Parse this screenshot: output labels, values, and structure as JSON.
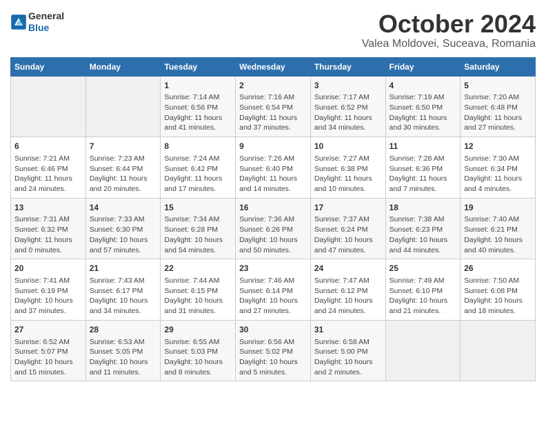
{
  "header": {
    "logo_line1": "General",
    "logo_line2": "Blue",
    "month": "October 2024",
    "location": "Valea Moldovei, Suceava, Romania"
  },
  "days_of_week": [
    "Sunday",
    "Monday",
    "Tuesday",
    "Wednesday",
    "Thursday",
    "Friday",
    "Saturday"
  ],
  "weeks": [
    [
      {
        "day": "",
        "info": ""
      },
      {
        "day": "",
        "info": ""
      },
      {
        "day": "1",
        "info": "Sunrise: 7:14 AM\nSunset: 6:56 PM\nDaylight: 11 hours and 41 minutes."
      },
      {
        "day": "2",
        "info": "Sunrise: 7:16 AM\nSunset: 6:54 PM\nDaylight: 11 hours and 37 minutes."
      },
      {
        "day": "3",
        "info": "Sunrise: 7:17 AM\nSunset: 6:52 PM\nDaylight: 11 hours and 34 minutes."
      },
      {
        "day": "4",
        "info": "Sunrise: 7:19 AM\nSunset: 6:50 PM\nDaylight: 11 hours and 30 minutes."
      },
      {
        "day": "5",
        "info": "Sunrise: 7:20 AM\nSunset: 6:48 PM\nDaylight: 11 hours and 27 minutes."
      }
    ],
    [
      {
        "day": "6",
        "info": "Sunrise: 7:21 AM\nSunset: 6:46 PM\nDaylight: 11 hours and 24 minutes."
      },
      {
        "day": "7",
        "info": "Sunrise: 7:23 AM\nSunset: 6:44 PM\nDaylight: 11 hours and 20 minutes."
      },
      {
        "day": "8",
        "info": "Sunrise: 7:24 AM\nSunset: 6:42 PM\nDaylight: 11 hours and 17 minutes."
      },
      {
        "day": "9",
        "info": "Sunrise: 7:26 AM\nSunset: 6:40 PM\nDaylight: 11 hours and 14 minutes."
      },
      {
        "day": "10",
        "info": "Sunrise: 7:27 AM\nSunset: 6:38 PM\nDaylight: 11 hours and 10 minutes."
      },
      {
        "day": "11",
        "info": "Sunrise: 7:28 AM\nSunset: 6:36 PM\nDaylight: 11 hours and 7 minutes."
      },
      {
        "day": "12",
        "info": "Sunrise: 7:30 AM\nSunset: 6:34 PM\nDaylight: 11 hours and 4 minutes."
      }
    ],
    [
      {
        "day": "13",
        "info": "Sunrise: 7:31 AM\nSunset: 6:32 PM\nDaylight: 11 hours and 0 minutes."
      },
      {
        "day": "14",
        "info": "Sunrise: 7:33 AM\nSunset: 6:30 PM\nDaylight: 10 hours and 57 minutes."
      },
      {
        "day": "15",
        "info": "Sunrise: 7:34 AM\nSunset: 6:28 PM\nDaylight: 10 hours and 54 minutes."
      },
      {
        "day": "16",
        "info": "Sunrise: 7:36 AM\nSunset: 6:26 PM\nDaylight: 10 hours and 50 minutes."
      },
      {
        "day": "17",
        "info": "Sunrise: 7:37 AM\nSunset: 6:24 PM\nDaylight: 10 hours and 47 minutes."
      },
      {
        "day": "18",
        "info": "Sunrise: 7:38 AM\nSunset: 6:23 PM\nDaylight: 10 hours and 44 minutes."
      },
      {
        "day": "19",
        "info": "Sunrise: 7:40 AM\nSunset: 6:21 PM\nDaylight: 10 hours and 40 minutes."
      }
    ],
    [
      {
        "day": "20",
        "info": "Sunrise: 7:41 AM\nSunset: 6:19 PM\nDaylight: 10 hours and 37 minutes."
      },
      {
        "day": "21",
        "info": "Sunrise: 7:43 AM\nSunset: 6:17 PM\nDaylight: 10 hours and 34 minutes."
      },
      {
        "day": "22",
        "info": "Sunrise: 7:44 AM\nSunset: 6:15 PM\nDaylight: 10 hours and 31 minutes."
      },
      {
        "day": "23",
        "info": "Sunrise: 7:46 AM\nSunset: 6:14 PM\nDaylight: 10 hours and 27 minutes."
      },
      {
        "day": "24",
        "info": "Sunrise: 7:47 AM\nSunset: 6:12 PM\nDaylight: 10 hours and 24 minutes."
      },
      {
        "day": "25",
        "info": "Sunrise: 7:49 AM\nSunset: 6:10 PM\nDaylight: 10 hours and 21 minutes."
      },
      {
        "day": "26",
        "info": "Sunrise: 7:50 AM\nSunset: 6:08 PM\nDaylight: 10 hours and 18 minutes."
      }
    ],
    [
      {
        "day": "27",
        "info": "Sunrise: 6:52 AM\nSunset: 5:07 PM\nDaylight: 10 hours and 15 minutes."
      },
      {
        "day": "28",
        "info": "Sunrise: 6:53 AM\nSunset: 5:05 PM\nDaylight: 10 hours and 11 minutes."
      },
      {
        "day": "29",
        "info": "Sunrise: 6:55 AM\nSunset: 5:03 PM\nDaylight: 10 hours and 8 minutes."
      },
      {
        "day": "30",
        "info": "Sunrise: 6:56 AM\nSunset: 5:02 PM\nDaylight: 10 hours and 5 minutes."
      },
      {
        "day": "31",
        "info": "Sunrise: 6:58 AM\nSunset: 5:00 PM\nDaylight: 10 hours and 2 minutes."
      },
      {
        "day": "",
        "info": ""
      },
      {
        "day": "",
        "info": ""
      }
    ]
  ]
}
